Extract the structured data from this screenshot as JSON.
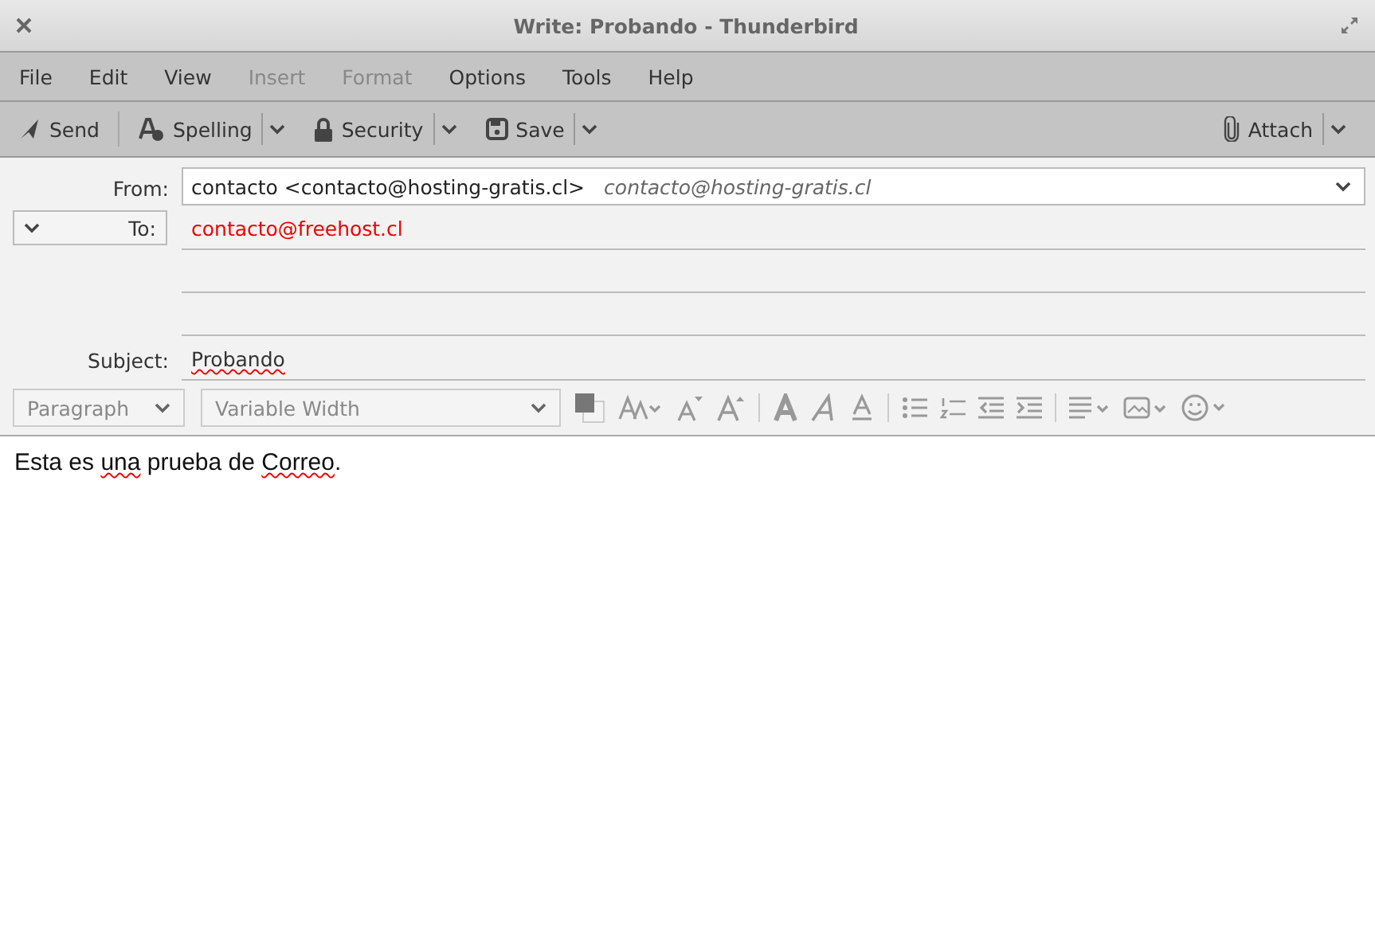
{
  "window": {
    "title": "Write: Probando - Thunderbird"
  },
  "menu": [
    {
      "label": "File",
      "disabled": false
    },
    {
      "label": "Edit",
      "disabled": false
    },
    {
      "label": "View",
      "disabled": false
    },
    {
      "label": "Insert",
      "disabled": true
    },
    {
      "label": "Format",
      "disabled": true
    },
    {
      "label": "Options",
      "disabled": false
    },
    {
      "label": "Tools",
      "disabled": false
    },
    {
      "label": "Help",
      "disabled": false
    }
  ],
  "toolbar": {
    "send": "Send",
    "spelling": "Spelling",
    "security": "Security",
    "save": "Save",
    "attach": "Attach"
  },
  "header": {
    "from_label": "From:",
    "from_value": "contacto <contacto@hosting-gratis.cl>",
    "from_identity": "contacto@hosting-gratis.cl",
    "to_label": "To:",
    "to_value": "contacto@freehost.cl",
    "subject_label": "Subject:",
    "subject_value": "Probando",
    "subject_misspelled": true
  },
  "format_bar": {
    "paragraph": "Paragraph",
    "font": "Variable Width"
  },
  "body": [
    {
      "text": "Esta es ",
      "misspelled": false
    },
    {
      "text": "una",
      "misspelled": true
    },
    {
      "text": " prueba de ",
      "misspelled": false
    },
    {
      "text": "Correo",
      "misspelled": true
    },
    {
      "text": ".",
      "misspelled": false
    }
  ]
}
